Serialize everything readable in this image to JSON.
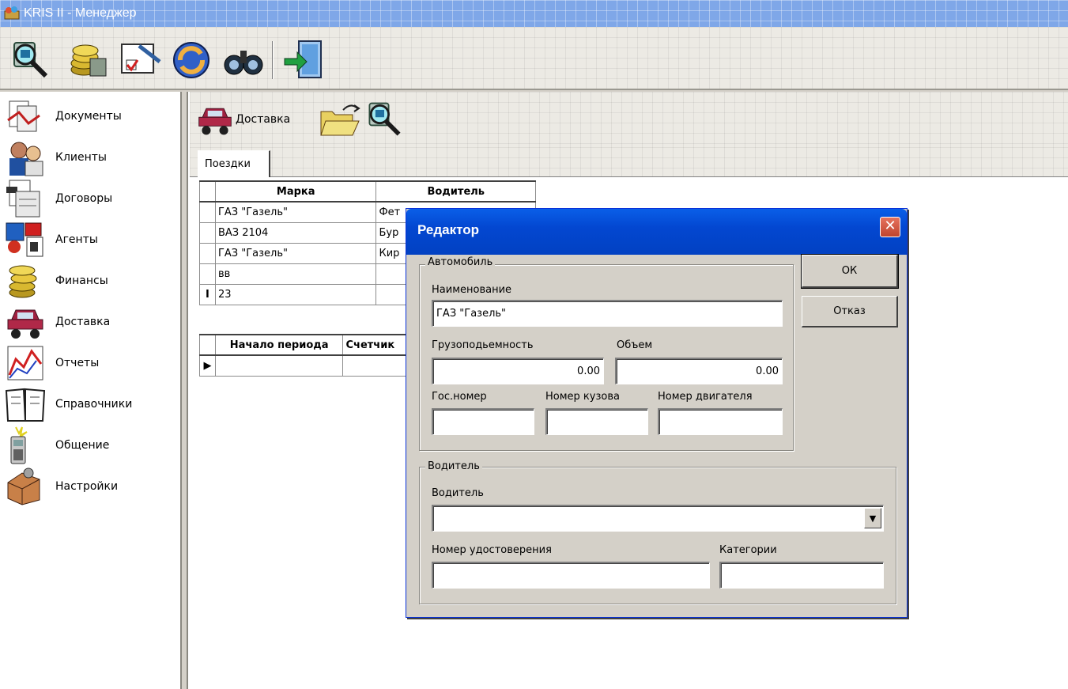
{
  "window": {
    "title": "KRIS II - Менеджер"
  },
  "sidebar": {
    "items": [
      {
        "label": "Документы"
      },
      {
        "label": "Клиенты"
      },
      {
        "label": "Договоры"
      },
      {
        "label": "Агенты"
      },
      {
        "label": "Финансы"
      },
      {
        "label": "Доставка"
      },
      {
        "label": "Отчеты"
      },
      {
        "label": "Справочники"
      },
      {
        "label": "Общение"
      },
      {
        "label": "Настройки"
      }
    ]
  },
  "module": {
    "delivery_label": "Доставка"
  },
  "tabs": [
    {
      "label": "Поездки"
    }
  ],
  "trips_grid": {
    "columns": [
      "Марка",
      "Водитель"
    ],
    "rows": [
      {
        "indicator": "",
        "brand": "ГАЗ \"Газель\"",
        "driver": "Фет"
      },
      {
        "indicator": "",
        "brand": "ВАЗ 2104",
        "driver": "Бур"
      },
      {
        "indicator": "",
        "brand": "ГАЗ \"Газель\"",
        "driver": "Кир"
      },
      {
        "indicator": "",
        "brand": "вв",
        "driver": ""
      },
      {
        "indicator": "I",
        "brand": "23",
        "driver": ""
      }
    ]
  },
  "period_grid": {
    "columns": [
      "Начало периода",
      "Счетчик"
    ],
    "rows": [
      {
        "indicator": "▶",
        "start": "",
        "counter": ""
      }
    ]
  },
  "dialog": {
    "title": "Редактор",
    "close_glyph": "✕",
    "ok_label": "ОК",
    "cancel_label": "Отказ",
    "car_group": {
      "caption": "Автомобиль",
      "name_label": "Наименование",
      "name_value": "ГАЗ \"Газель\"",
      "capacity_label": "Грузоподьемность",
      "capacity_value": "0.00",
      "volume_label": "Объем",
      "volume_value": "0.00",
      "plate_label": "Гос.номер",
      "plate_value": "",
      "body_label": "Номер кузова",
      "body_value": "",
      "engine_label": "Номер двигателя",
      "engine_value": ""
    },
    "driver_group": {
      "caption": "Водитель",
      "driver_label": "Водитель",
      "driver_value": "",
      "license_label": "Номер удостоверения",
      "license_value": "",
      "categories_label": "Категории",
      "categories_value": ""
    }
  },
  "colors": {
    "title_bar": "#7fa7e8",
    "dialog_title": "#0347d1",
    "close_button": "#c0442e"
  }
}
